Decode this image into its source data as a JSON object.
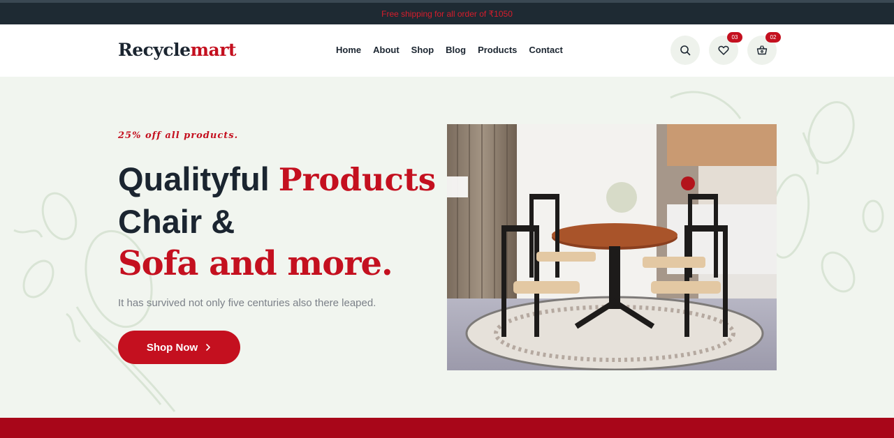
{
  "topbar": {
    "promo": "Free shipping for all order of ₹1050"
  },
  "header": {
    "logo_part1": "Recycle",
    "logo_part2": "mart",
    "nav": [
      "Home",
      "About",
      "Shop",
      "Blog",
      "Products",
      "Contact"
    ],
    "icons": {
      "search": "search-icon",
      "wishlist": "heart-icon",
      "cart": "basket-icon"
    },
    "wishlist_count": "03",
    "cart_count": "02"
  },
  "hero": {
    "tagline": "25% off all products.",
    "heading_dark": "Qualityful",
    "heading_red": "Products",
    "heading_line2": "Chair &",
    "heading_line3": "Sofa and more.",
    "subtext": "It has survived not only five centuries also there leaped.",
    "cta_label": "Shop Now"
  },
  "colors": {
    "accent": "#c4101f",
    "dark": "#1b2530",
    "topbar": "#1e2a33",
    "hero_bg": "#f1f5ef",
    "band": "#a80619"
  }
}
